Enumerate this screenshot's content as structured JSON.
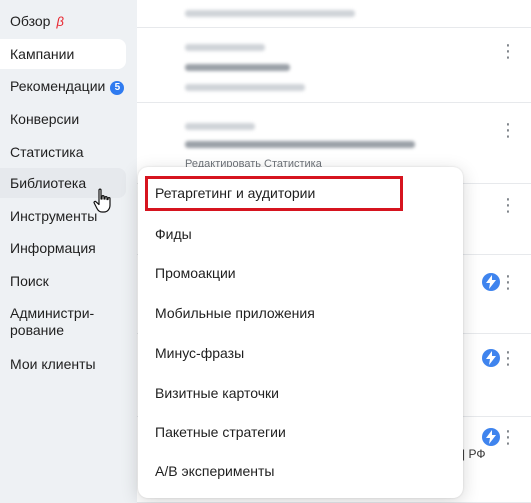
{
  "sidebar": {
    "items": [
      {
        "label": "Обзор",
        "beta": "β"
      },
      {
        "label": "Кампании"
      },
      {
        "label": "Рекомендации",
        "badge": "5"
      },
      {
        "label": "Конверсии"
      },
      {
        "label": "Статистика"
      },
      {
        "label": "Библиотека"
      },
      {
        "label": "Инструменты"
      },
      {
        "label": "Информация"
      },
      {
        "label": "Поиск"
      },
      {
        "label": "Админист­ри-",
        "label2": "рование"
      },
      {
        "label": "Мои клиенты"
      }
    ]
  },
  "main": {
    "row_actions": "Редактировать  Статистика",
    "region_suffix": "| РФ"
  },
  "library_menu": {
    "items": [
      "Ретаргетинг и аудитории",
      "Фиды",
      "Промоакции",
      "Мобильные приложения",
      "Минус-фразы",
      "Визитные карточки",
      "Пакетные стратегии",
      "A/B эксперименты"
    ]
  },
  "colors": {
    "highlight": "#d6141f",
    "badge": "#2f7bf0",
    "beta": "#e8242e",
    "bolt": "#3f84ee"
  }
}
